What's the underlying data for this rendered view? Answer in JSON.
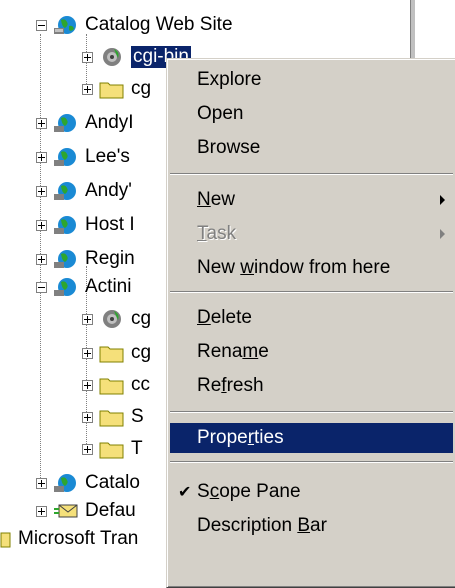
{
  "tree": {
    "root_top_label": "Catalog Web Site",
    "selected_label": "cgi-bin",
    "nodes": [
      {
        "label": "cgi-bin",
        "icon": "gear-globe-icon",
        "expander": "plus"
      },
      {
        "label": "cg",
        "icon": "folder-icon",
        "expander": "plus"
      },
      {
        "label": "AndyI",
        "icon": "globe-icon",
        "expander": "plus"
      },
      {
        "label": "Lee's",
        "icon": "globe-icon",
        "expander": "plus"
      },
      {
        "label": "Andy'",
        "icon": "globe-icon",
        "expander": "plus"
      },
      {
        "label": "Host I",
        "icon": "globe-icon",
        "expander": "plus"
      },
      {
        "label": "Regin",
        "icon": "globe-icon",
        "expander": "plus"
      },
      {
        "label": "Actini",
        "icon": "globe-icon",
        "expander": "minus"
      },
      {
        "label": "cg",
        "icon": "gear-globe-icon",
        "expander": "plus"
      },
      {
        "label": "cg",
        "icon": "folder-icon",
        "expander": "plus"
      },
      {
        "label": "cc",
        "icon": "folder-icon",
        "expander": "plus"
      },
      {
        "label": "S",
        "icon": "folder-icon",
        "expander": "plus"
      },
      {
        "label": "T",
        "icon": "folder-icon",
        "expander": "plus"
      },
      {
        "label": "Catalo",
        "icon": "globe-icon",
        "expander": "plus"
      },
      {
        "label": "Defau",
        "icon": "mail-icon",
        "expander": "plus"
      },
      {
        "label": "Microsoft Tran",
        "icon": "book-icon",
        "expander": "none"
      }
    ]
  },
  "menu": {
    "explore": "Explore",
    "open": "Open",
    "browse": "Browse",
    "new": {
      "pre": "",
      "key": "N",
      "post": "ew"
    },
    "task": {
      "pre": "",
      "key": "T",
      "post": "ask"
    },
    "new_window": {
      "pre": "New ",
      "key": "w",
      "post": "indow from here"
    },
    "delete": {
      "pre": "",
      "key": "D",
      "post": "elete"
    },
    "rename": {
      "pre": "Rena",
      "key": "m",
      "post": "e"
    },
    "refresh": {
      "pre": "Re",
      "key": "f",
      "post": "resh"
    },
    "properties": {
      "pre": "Prope",
      "key": "r",
      "post": "ties"
    },
    "scope_pane": {
      "pre": "S",
      "key": "c",
      "post": "ope Pane"
    },
    "description_bar": {
      "pre": "Description ",
      "key": "B",
      "post": "ar"
    },
    "check_glyph": "✔"
  },
  "colors": {
    "highlight": "#0a246a",
    "menu_face": "#d4d0c8",
    "disabled_text": "#808080"
  }
}
